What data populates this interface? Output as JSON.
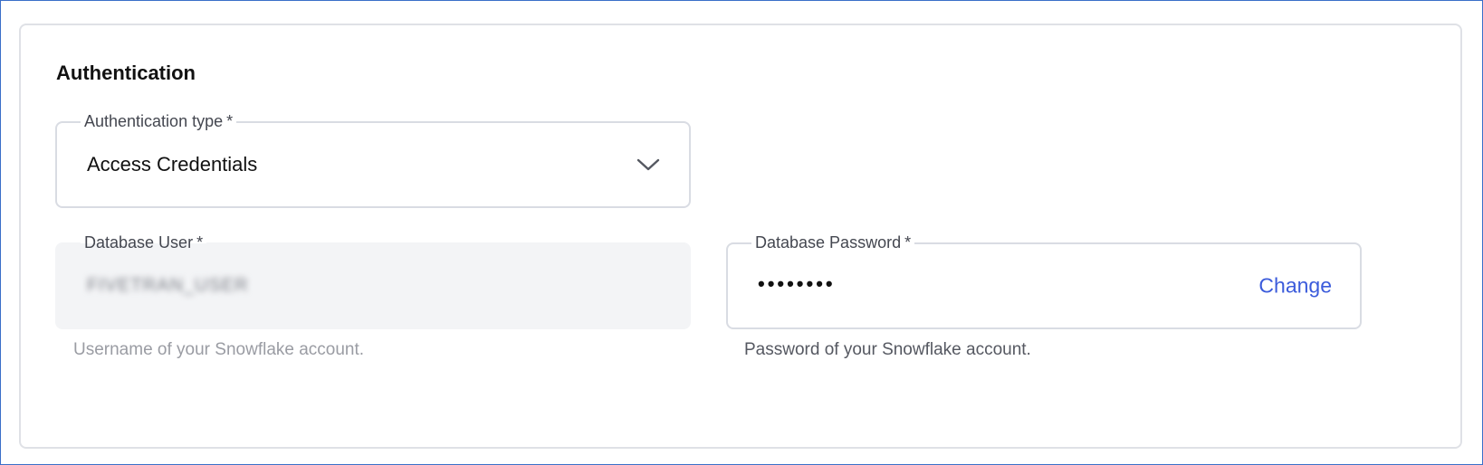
{
  "section": {
    "title": "Authentication"
  },
  "auth_type": {
    "label": "Authentication type",
    "required_mark": "*",
    "value": "Access Credentials",
    "icon": "chevron-down-icon"
  },
  "db_user": {
    "label": "Database User",
    "required_mark": "*",
    "value": "FIVETRAN_USER",
    "helper": "Username of your Snowflake account.",
    "disabled": true
  },
  "db_password": {
    "label": "Database Password",
    "required_mark": "*",
    "value": "••••••••",
    "action_label": "Change",
    "helper": "Password of your Snowflake account."
  },
  "colors": {
    "link": "#3b5bdb",
    "border": "#d9dce3",
    "disabled_bg": "#f3f4f6"
  }
}
